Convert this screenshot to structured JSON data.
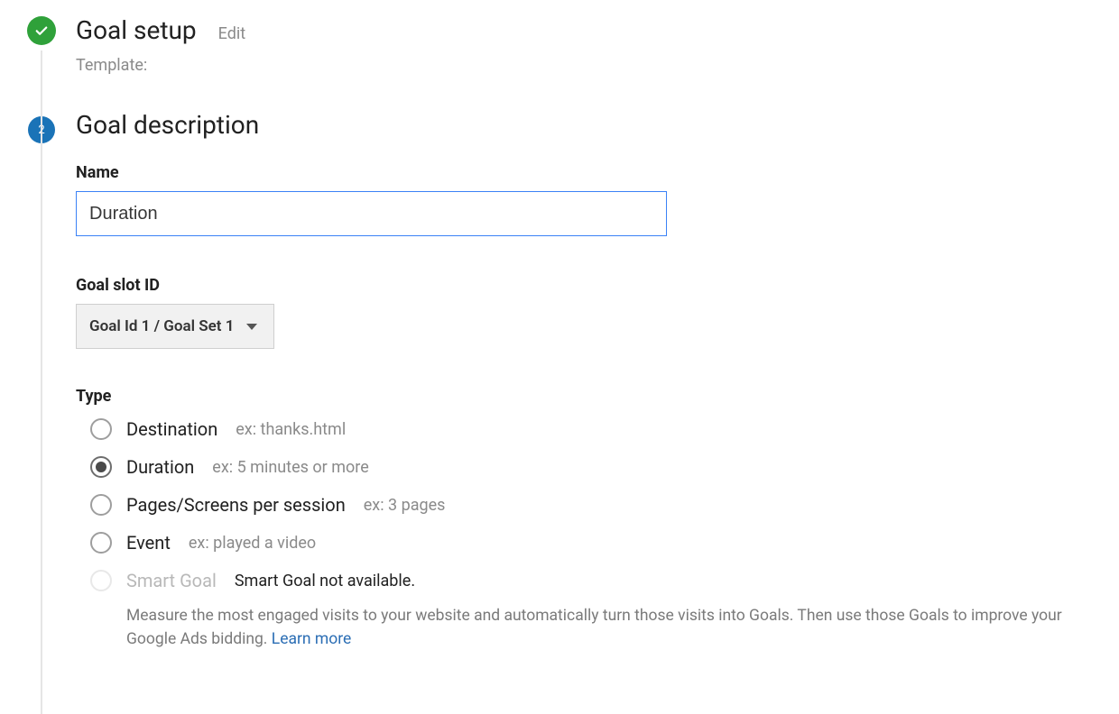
{
  "step1": {
    "title": "Goal setup",
    "edit": "Edit",
    "template_label": "Template:"
  },
  "step2": {
    "number": "2",
    "title": "Goal description",
    "name_label": "Name",
    "name_value": "Duration",
    "slot_label": "Goal slot ID",
    "slot_value": "Goal Id 1 / Goal Set 1",
    "type_label": "Type",
    "types": [
      {
        "label": "Destination",
        "ex": "ex: thanks.html"
      },
      {
        "label": "Duration",
        "ex": "ex: 5 minutes or more"
      },
      {
        "label": "Pages/Screens per session",
        "ex": "ex: 3 pages"
      },
      {
        "label": "Event",
        "ex": "ex: played a video"
      }
    ],
    "smart": {
      "label": "Smart Goal",
      "note": "Smart Goal not available.",
      "desc": "Measure the most engaged visits to your website and automatically turn those visits into Goals. Then use those Goals to improve your Google Ads bidding. ",
      "learn": "Learn more"
    }
  }
}
